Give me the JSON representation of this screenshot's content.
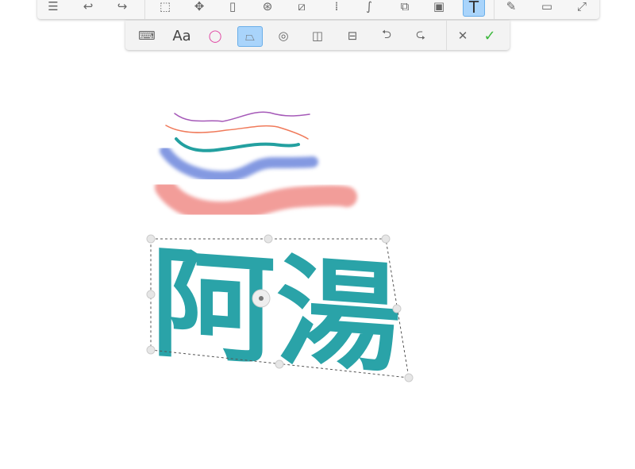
{
  "top_toolbar": {
    "tools": [
      {
        "name": "list-icon",
        "glyph": "☰"
      },
      {
        "name": "undo-icon",
        "glyph": "↩"
      },
      {
        "name": "redo-icon",
        "glyph": "↪"
      },
      {
        "name": "select-icon",
        "glyph": "⬚"
      },
      {
        "name": "move-icon",
        "glyph": "✥"
      },
      {
        "name": "eraser-icon",
        "glyph": "▯"
      },
      {
        "name": "color-mix-icon",
        "glyph": "⊛"
      },
      {
        "name": "ruler-icon",
        "glyph": "⧄"
      },
      {
        "name": "symmetry-icon",
        "glyph": "⁞"
      },
      {
        "name": "curve-icon",
        "glyph": "∫"
      },
      {
        "name": "shapes-icon",
        "glyph": "⧉"
      },
      {
        "name": "image-icon",
        "glyph": "▣"
      },
      {
        "name": "text-icon",
        "glyph": "T",
        "active": true
      },
      {
        "name": "pen-icon",
        "glyph": "✎"
      },
      {
        "name": "window-icon",
        "glyph": "▭"
      },
      {
        "name": "fullscreen-icon",
        "glyph": "⤢"
      }
    ]
  },
  "text_toolbar": {
    "tools": [
      {
        "name": "keyboard-icon",
        "glyph": "⌨"
      },
      {
        "name": "font-button",
        "glyph": "Aa"
      },
      {
        "name": "color-wheel-icon",
        "glyph": "◯"
      },
      {
        "name": "perspective-icon",
        "glyph": "⏢",
        "active": true
      },
      {
        "name": "joystick-icon",
        "glyph": "◎"
      },
      {
        "name": "flip-horizontal-icon",
        "glyph": "◫"
      },
      {
        "name": "flip-vertical-icon",
        "glyph": "⊟"
      },
      {
        "name": "rotate-left-icon",
        "glyph": "⮌"
      },
      {
        "name": "rotate-right-icon",
        "glyph": "⮎"
      },
      {
        "name": "cancel-icon",
        "glyph": "✕"
      },
      {
        "name": "confirm-icon",
        "glyph": "✓"
      }
    ]
  },
  "canvas": {
    "text": "阿湯",
    "text_color": "#2aa3a8",
    "strokes": [
      {
        "color": "#a559b8"
      },
      {
        "color": "#f07a5a"
      },
      {
        "color": "#23a0a0"
      },
      {
        "color": "#5a77d8"
      },
      {
        "color": "#f08c88"
      }
    ]
  }
}
